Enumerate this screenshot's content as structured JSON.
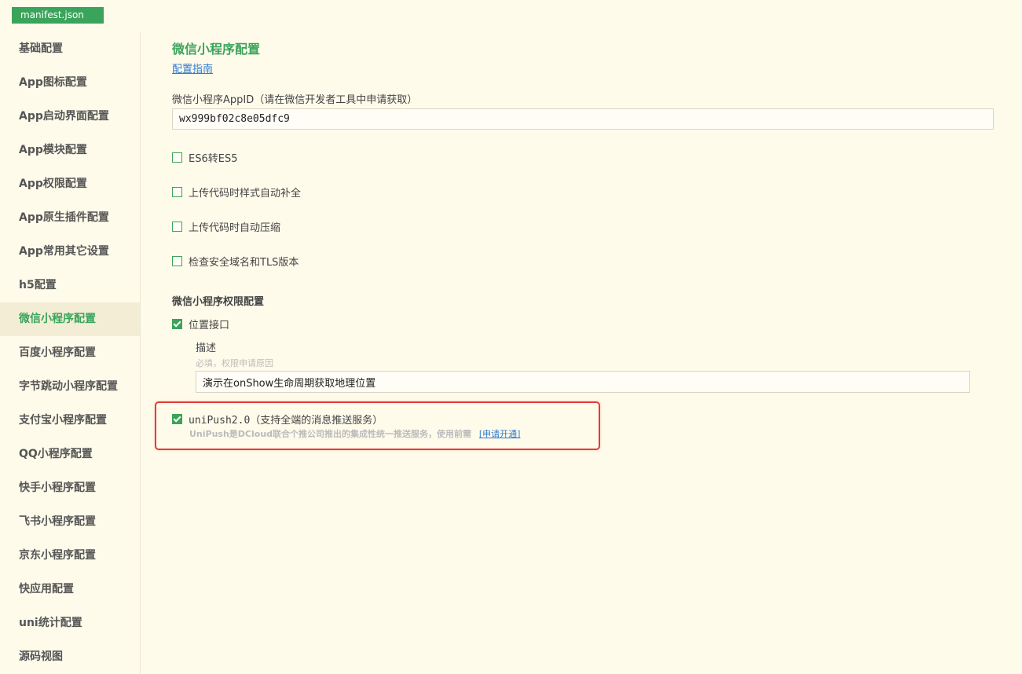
{
  "tab": {
    "label": "manifest.json"
  },
  "sidebar": {
    "items": [
      {
        "label": "基础配置"
      },
      {
        "label": "App图标配置"
      },
      {
        "label": "App启动界面配置"
      },
      {
        "label": "App模块配置"
      },
      {
        "label": "App权限配置"
      },
      {
        "label": "App原生插件配置"
      },
      {
        "label": "App常用其它设置"
      },
      {
        "label": "h5配置"
      },
      {
        "label": "微信小程序配置"
      },
      {
        "label": "百度小程序配置"
      },
      {
        "label": "字节跳动小程序配置"
      },
      {
        "label": "支付宝小程序配置"
      },
      {
        "label": "QQ小程序配置"
      },
      {
        "label": "快手小程序配置"
      },
      {
        "label": "飞书小程序配置"
      },
      {
        "label": "京东小程序配置"
      },
      {
        "label": "快应用配置"
      },
      {
        "label": "uni统计配置"
      },
      {
        "label": "源码视图"
      }
    ],
    "active_label": "微信小程序配置"
  },
  "main": {
    "title": "微信小程序配置",
    "guide_link": "配置指南",
    "appid_label": "微信小程序AppID（请在微信开发者工具中申请获取）",
    "appid_value": "wx999bf02c8e05dfc9",
    "checkboxes": [
      {
        "label": "ES6转ES5",
        "checked": false
      },
      {
        "label": "上传代码时样式自动补全",
        "checked": false
      },
      {
        "label": "上传代码时自动压缩",
        "checked": false
      },
      {
        "label": "检查安全域名和TLS版本",
        "checked": false
      }
    ],
    "permission_section_title": "微信小程序权限配置",
    "location_permission": {
      "label": "位置接口",
      "checked": true,
      "desc_label": "描述",
      "desc_hint": "必填，权限申请原因",
      "desc_value": "演示在onShow生命周期获取地理位置"
    },
    "unipush": {
      "label": "uniPush2.0（支持全端的消息推送服务）",
      "checked": true,
      "description": "UniPush是DCloud联合个推公司推出的集成性统一推送服务，使用前需",
      "link": "[申请开通]"
    }
  },
  "colors": {
    "accent": "#3aa45b",
    "background": "#fffbeb",
    "link": "#2d7bd1",
    "highlight": "#e23b3b"
  }
}
